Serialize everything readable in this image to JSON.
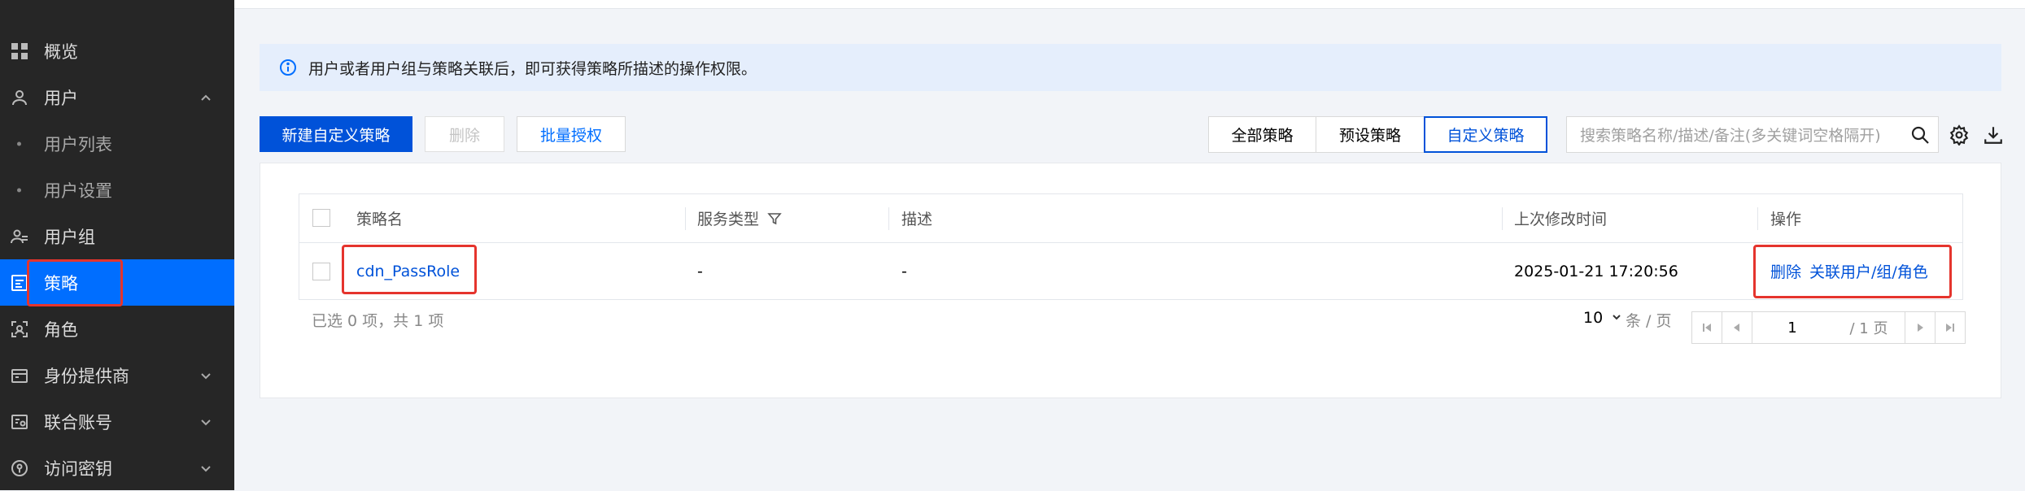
{
  "sidebar": {
    "items": [
      {
        "label": "概览"
      },
      {
        "label": "用户"
      },
      {
        "label": "用户列表"
      },
      {
        "label": "用户设置"
      },
      {
        "label": "用户组"
      },
      {
        "label": "策略"
      },
      {
        "label": "角色"
      },
      {
        "label": "身份提供商"
      },
      {
        "label": "联合账号"
      },
      {
        "label": "访问密钥"
      }
    ]
  },
  "notice": {
    "text": "用户或者用户组与策略关联后，即可获得策略所描述的操作权限。"
  },
  "toolbar": {
    "new_label": "新建自定义策略",
    "delete_label": "删除",
    "batch_label": "批量授权",
    "filters": [
      "全部策略",
      "预设策略",
      "自定义策略"
    ],
    "search_placeholder": "搜索策略名称/描述/备注(多关键词空格隔开)"
  },
  "table": {
    "headers": {
      "name": "策略名",
      "service": "服务类型",
      "desc": "描述",
      "modified": "上次修改时间",
      "ops": "操作"
    },
    "rows": [
      {
        "name": "cdn_PassRole",
        "service": "-",
        "desc": "-",
        "modified": "2025-01-21 17:20:56",
        "op_delete": "删除",
        "op_associate": "关联用户/组/角色"
      }
    ]
  },
  "footer": {
    "selection": "已选 0 项，共 1 项",
    "page_size": "10",
    "page_size_unit": "条 / 页",
    "page_input": "1",
    "page_total": "/ 1 页"
  },
  "colors": {
    "accent": "#0052d9",
    "active_nav": "#006eff",
    "highlight": "#e5342d"
  }
}
